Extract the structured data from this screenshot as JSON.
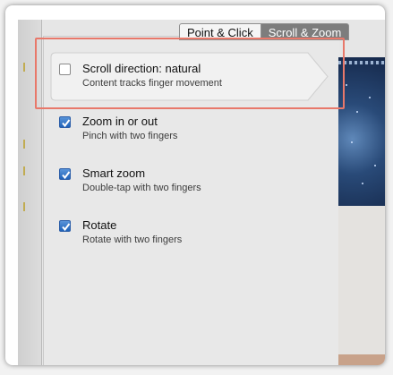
{
  "tabs": [
    {
      "label": "Point & Click",
      "active": false
    },
    {
      "label": "Scroll & Zoom",
      "active": true
    }
  ],
  "options": [
    {
      "title": "Scroll direction: natural",
      "subtitle": "Content tracks finger movement",
      "checked": false
    },
    {
      "title": "Zoom in or out",
      "subtitle": "Pinch with two fingers",
      "checked": true
    },
    {
      "title": "Smart zoom",
      "subtitle": "Double-tap with two fingers",
      "checked": true
    },
    {
      "title": "Rotate",
      "subtitle": "Rotate with two fingers",
      "checked": true
    }
  ],
  "colors": {
    "highlight": "#e8786a",
    "checkbox_checked": "#2a6fc4",
    "active_tab": "#7d7d7d"
  }
}
